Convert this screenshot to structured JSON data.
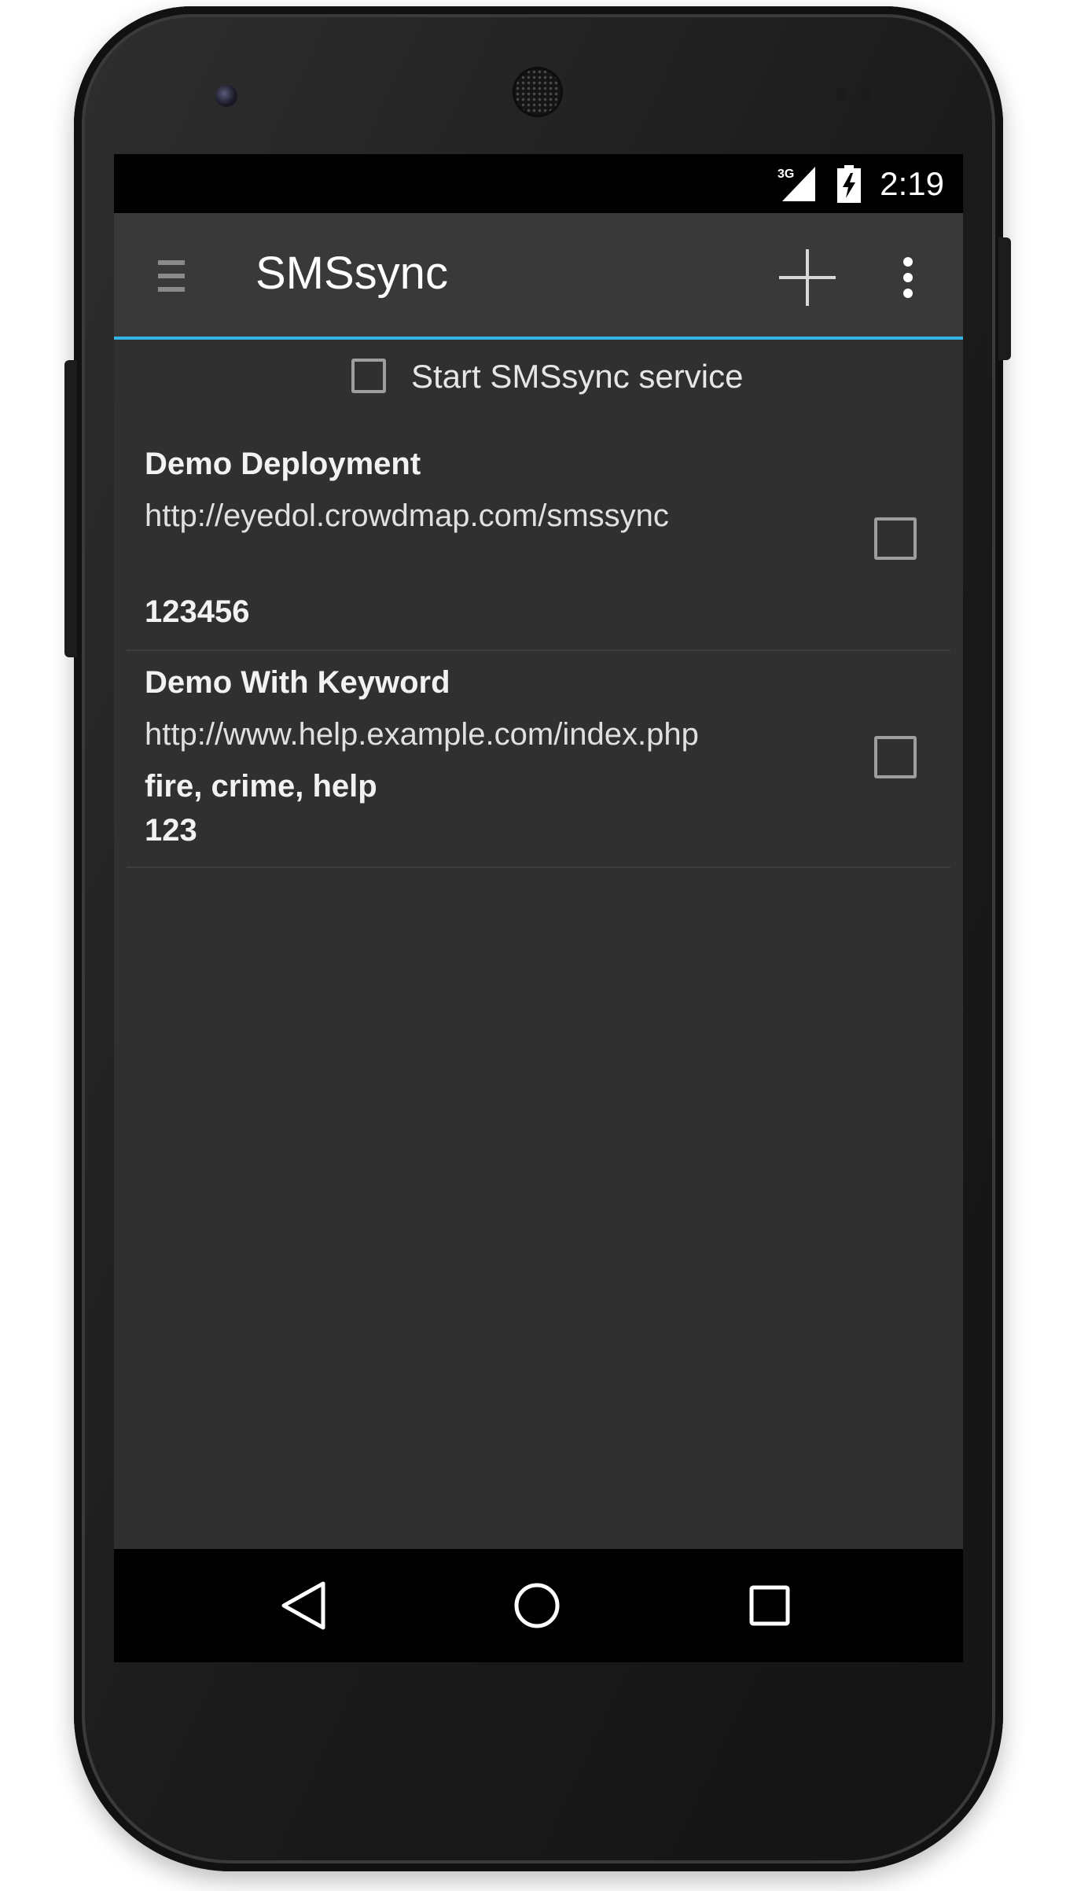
{
  "status_bar": {
    "network_label": "3G",
    "time": "2:19"
  },
  "action_bar": {
    "title": "SMSsync",
    "icons": [
      "menu-drawer-icon",
      "add-icon",
      "overflow-menu-icon"
    ],
    "accent_color": "#33b5e5"
  },
  "service": {
    "label": "Start SMSsync service",
    "checked": false
  },
  "sync_urls": [
    {
      "title": "Demo Deployment",
      "url": "http://eyedol.crowdmap.com/smssync",
      "keywords": "",
      "secret": "123456",
      "checked": false
    },
    {
      "title": "Demo With Keyword",
      "url": "http://www.help.example.com/index.php",
      "keywords": "fire, crime, help",
      "secret": "123",
      "checked": false
    }
  ],
  "nav_bar": {
    "icons": [
      "back-icon",
      "home-icon",
      "recents-icon"
    ]
  }
}
